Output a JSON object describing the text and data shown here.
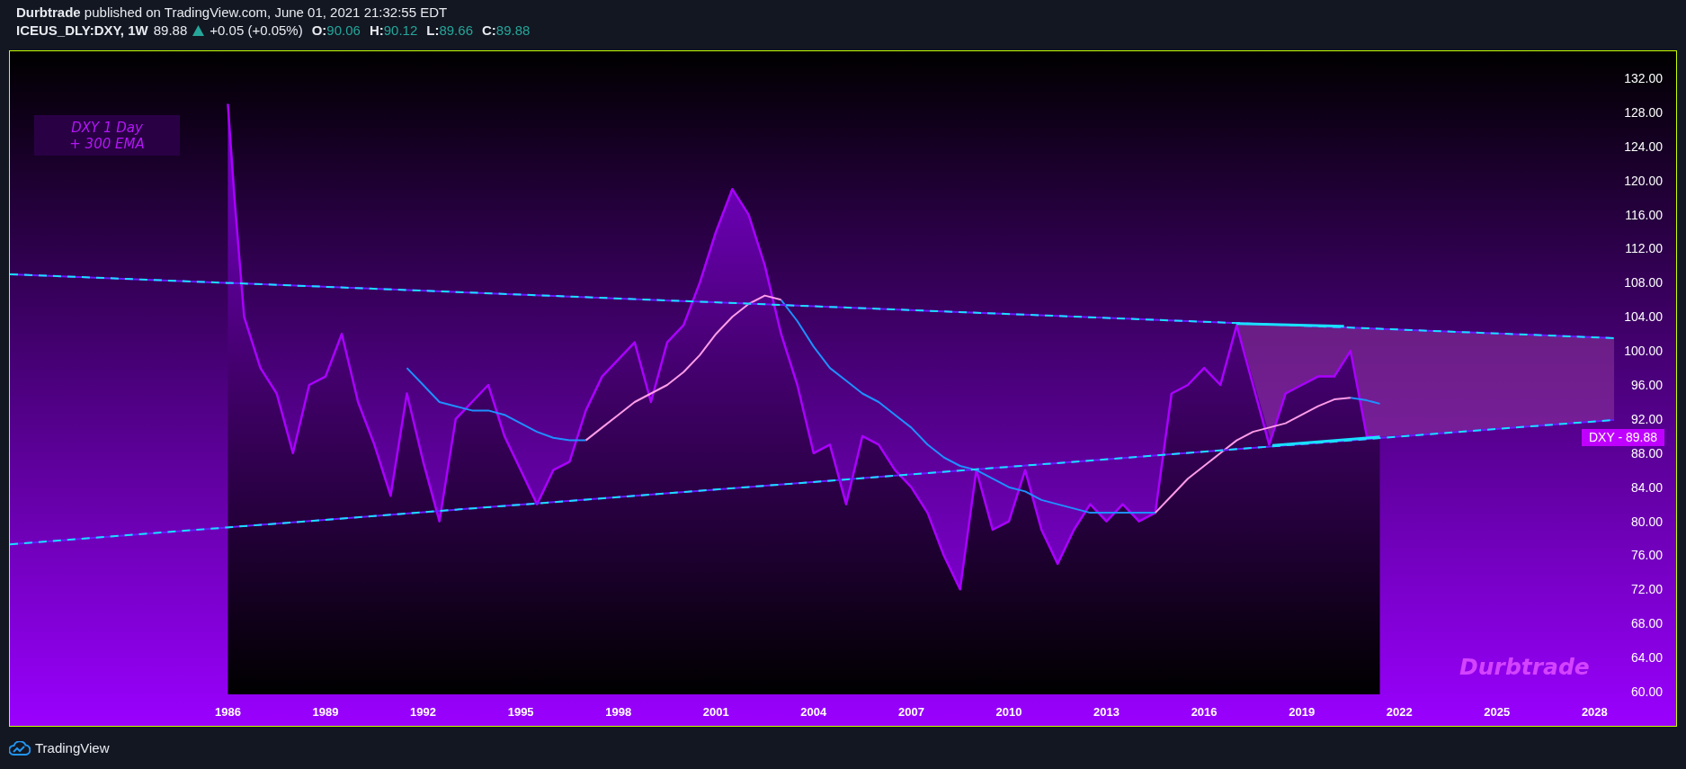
{
  "header": {
    "published": "**Durbtrade** published on TradingView.com, June 01, 2021 21:32:55 EDT",
    "symbol": "ICEUS_DLY:DXY, 1W",
    "last": "89.88",
    "rising": true,
    "change": "+0.05 (+0.05%)",
    "ohlc": [
      {
        "label": "O:",
        "value": "90.06"
      },
      {
        "label": "H:",
        "value": "90.12"
      },
      {
        "label": "L:",
        "value": "89.66"
      },
      {
        "label": "C:",
        "value": "89.88"
      }
    ]
  },
  "chart": {
    "text_box": {
      "lines": [
        "DXY 1 Day",
        "+ 300 EMA"
      ]
    },
    "signature": "Durbtrade",
    "price_tag": "DXY - 89.88",
    "chart_data": {
      "type": "area",
      "xlim": [
        1986,
        2028
      ],
      "ylim": [
        60,
        132
      ],
      "xticks": [
        1986,
        1989,
        1992,
        1995,
        1998,
        2001,
        2004,
        2007,
        2010,
        2013,
        2016,
        2019,
        2022,
        2025,
        2028
      ],
      "yticks": [
        {
          "value": 132,
          "label": "132.00"
        },
        {
          "value": 128,
          "label": "128.00"
        },
        {
          "value": 124,
          "label": "124.00"
        },
        {
          "value": 120,
          "label": "120.00"
        },
        {
          "value": 116,
          "label": "116.00"
        },
        {
          "value": 112,
          "label": "112.00"
        },
        {
          "value": 108,
          "label": "108.00"
        },
        {
          "value": 104,
          "label": "104.00"
        },
        {
          "value": 100,
          "label": "100.00"
        },
        {
          "value": 96,
          "label": "96.00"
        },
        {
          "value": 92,
          "label": "92.00"
        },
        {
          "value": 88,
          "label": "88.00"
        },
        {
          "value": 84,
          "label": "84.00"
        },
        {
          "value": 80,
          "label": "80.00"
        },
        {
          "value": 76,
          "label": "76.00"
        },
        {
          "value": 72,
          "label": "72.00"
        },
        {
          "value": 68,
          "label": "68.00"
        },
        {
          "value": 64,
          "label": "64.00"
        },
        {
          "value": 60,
          "label": "60.00"
        }
      ],
      "x": [
        1986,
        1986.2,
        1986.5,
        1987,
        1987.5,
        1988,
        1988.5,
        1989,
        1989.5,
        1990,
        1990.5,
        1991,
        1991.5,
        1992,
        1992.5,
        1993,
        1993.5,
        1994,
        1994.5,
        1995,
        1995.5,
        1996,
        1996.5,
        1997,
        1997.5,
        1998,
        1998.5,
        1999,
        1999.5,
        2000,
        2000.5,
        2001,
        2001.5,
        2002,
        2002.5,
        2003,
        2003.5,
        2004,
        2004.5,
        2005,
        2005.5,
        2006,
        2006.5,
        2007,
        2007.5,
        2008,
        2008.5,
        2009,
        2009.5,
        2010,
        2010.5,
        2011,
        2011.5,
        2012,
        2012.5,
        2013,
        2013.5,
        2014,
        2014.5,
        2015,
        2015.5,
        2016,
        2016.5,
        2017,
        2017.5,
        2018,
        2018.5,
        2019,
        2019.5,
        2020,
        2020.5,
        2021,
        2021.4
      ],
      "series": [
        {
          "color": "#aa00ff",
          "values": [
            129,
            118,
            104,
            98,
            95,
            88,
            96,
            97,
            102,
            94,
            89,
            83,
            95,
            87,
            80,
            92,
            94,
            96,
            90,
            86,
            82,
            86,
            87,
            93,
            97,
            99,
            101,
            94,
            101,
            103,
            108,
            114,
            119,
            116,
            110,
            102,
            96,
            88,
            89,
            82,
            90,
            89,
            86,
            84,
            81,
            76,
            72,
            86,
            79,
            80,
            86,
            79,
            75,
            79,
            82,
            80,
            82,
            80,
            81,
            95,
            96,
            98,
            96,
            103,
            96,
            89,
            95,
            96,
            97,
            97,
            100,
            90,
            89.9
          ]
        },
        {
          "type": "line",
          "color": "#1e90ff",
          "values": [
            null,
            null,
            null,
            null,
            null,
            null,
            null,
            null,
            null,
            null,
            null,
            null,
            98,
            96,
            94,
            93.5,
            93,
            93,
            92.5,
            91.5,
            90.5,
            89.8,
            89.5,
            89.5,
            null,
            null,
            null,
            null,
            null,
            null,
            null,
            null,
            null,
            null,
            null,
            106,
            103.5,
            100.5,
            98,
            96.5,
            95,
            94,
            92.5,
            91,
            89,
            87.5,
            86.5,
            86,
            85,
            84,
            83.5,
            82.5,
            82,
            81.5,
            81,
            81,
            81,
            81,
            81,
            null,
            null,
            null,
            null,
            null,
            null,
            null,
            null,
            null,
            null,
            null,
            94.5,
            94.2,
            93.8
          ]
        },
        {
          "type": "line",
          "color": "#ff9ce8",
          "values": [
            null,
            null,
            null,
            null,
            null,
            null,
            null,
            null,
            null,
            null,
            null,
            null,
            null,
            null,
            null,
            null,
            null,
            null,
            null,
            null,
            null,
            null,
            null,
            89.5,
            91,
            92.5,
            94,
            95,
            96,
            97.5,
            99.5,
            102,
            104,
            105.5,
            106.5,
            106,
            null,
            null,
            null,
            null,
            null,
            null,
            null,
            null,
            null,
            null,
            null,
            null,
            null,
            null,
            null,
            null,
            null,
            null,
            null,
            null,
            null,
            null,
            81,
            83,
            85,
            86.5,
            88,
            89.5,
            90.5,
            91,
            91.5,
            92.5,
            93.5,
            94.3,
            94.5,
            null,
            null
          ]
        }
      ]
    }
  },
  "footer": {
    "brand": "TradingView"
  }
}
